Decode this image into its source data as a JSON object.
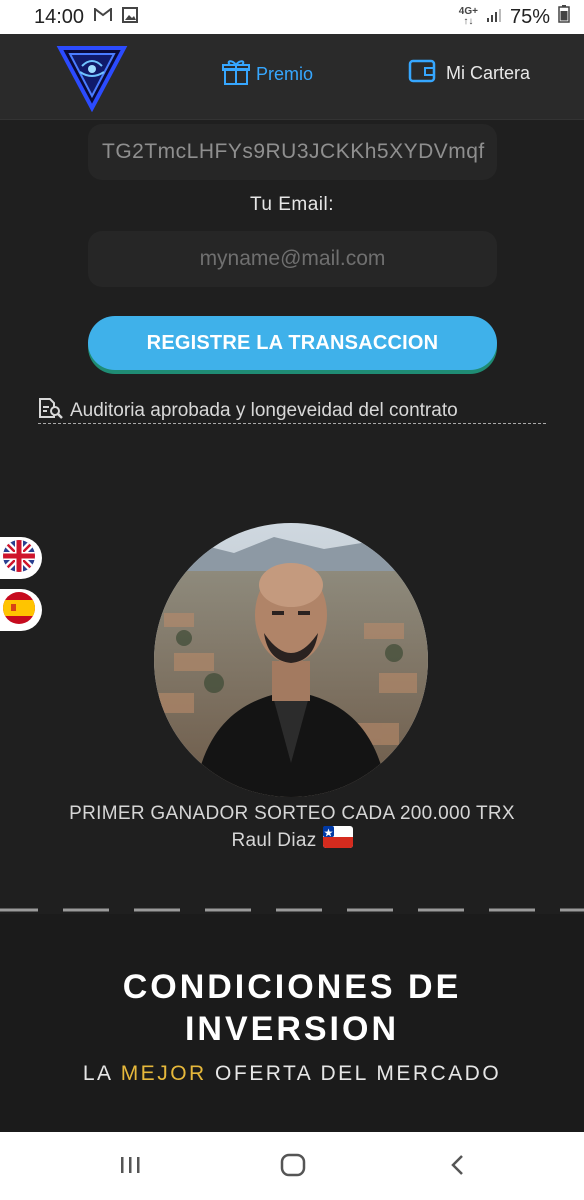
{
  "status_bar": {
    "time": "14:00",
    "network_top": "4G+",
    "network_bottom": "↑↓",
    "battery": "75%"
  },
  "header": {
    "nav": [
      {
        "label": "Premio",
        "icon": "gift-icon",
        "color": "#36a7ff"
      },
      {
        "label": "Mi Cartera",
        "icon": "wallet-icon"
      }
    ]
  },
  "form": {
    "wallet_value": "TG2TmcLHFYs9RU3JCKKh5XYDVmqf",
    "email_label": "Tu Email:",
    "email_placeholder": "myname@mail.com",
    "register_label": "REGISTRE LA TRANSACCION",
    "audit_link": "Auditoria aprobada y longeveidad del contrato"
  },
  "winner": {
    "caption": "PRIMER GANADOR SORTEO CADA 200.000 TRX",
    "name": "Raul Diaz",
    "flag": "chile-flag-icon"
  },
  "section": {
    "title_line1": "CONDICIONES DE",
    "title_line2": "INVERSION",
    "subtitle_pre": "LA",
    "subtitle_highlight": "MEJOR",
    "subtitle_post": "OFERTA DEL MERCADO"
  },
  "colors": {
    "accent": "#3fb1ea",
    "highlight": "#e6b83b",
    "background": "#1f1f1f"
  }
}
